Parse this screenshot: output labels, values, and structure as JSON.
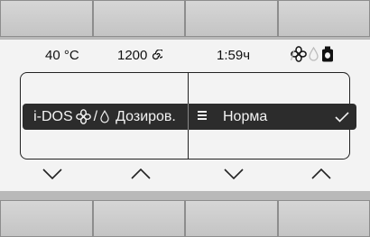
{
  "status_bar": {
    "temperature": "40 °C",
    "spin_speed": "1200",
    "spin_icon": "spiral-icon",
    "remaining_time": "1:59ч",
    "icons": [
      "softener-flower-icon",
      "detergent-drop-icon",
      "detergent-bottle-icon"
    ]
  },
  "option_row": {
    "left_prefix": "i-DOS",
    "left_icons": [
      "softener-flower-icon",
      "detergent-drop-icon"
    ],
    "left_separator": "/",
    "left_label": "Дозиров.",
    "right_icon": "level-bars-icon",
    "right_value": "Норма",
    "confirm_icon": "checkmark-icon"
  },
  "arrows": [
    "chevron-down-icon",
    "chevron-up-icon",
    "chevron-down-icon",
    "chevron-up-icon"
  ],
  "colors": {
    "screen_bg": "#f3f3f3",
    "selection_bg": "#2c2c2c",
    "bezel": "#b9b9b9"
  }
}
